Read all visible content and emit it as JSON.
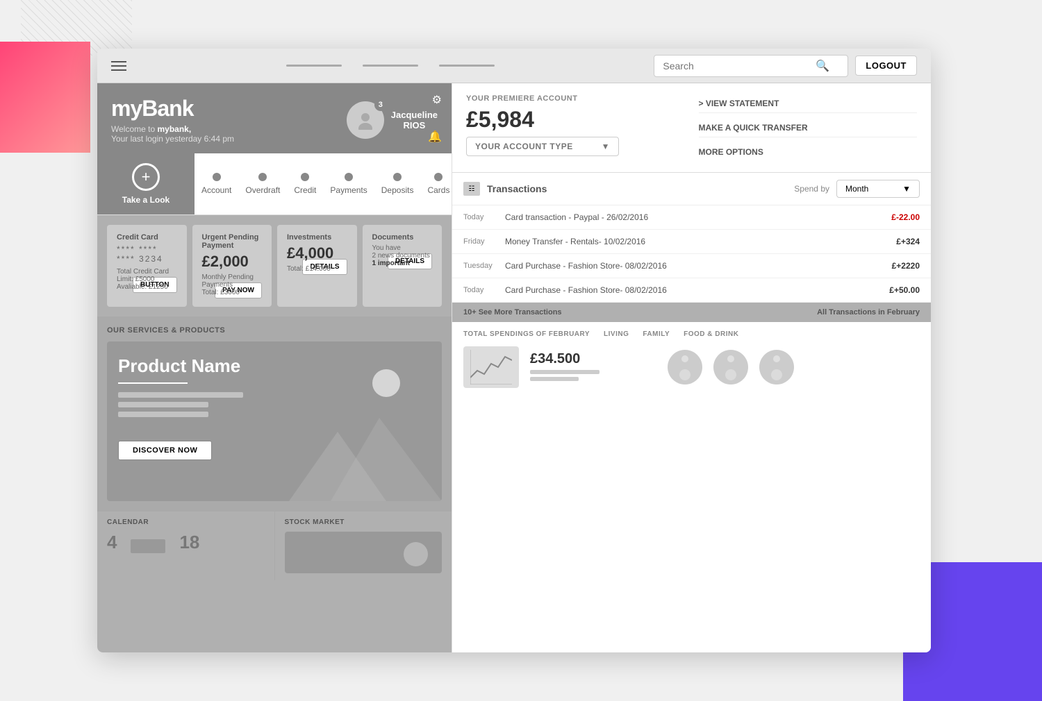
{
  "browser": {
    "hamburger_label": "menu",
    "search_placeholder": "Search",
    "logout_label": "LOGOUT"
  },
  "bank": {
    "logo": "myBank",
    "welcome_text": "Welcome to",
    "welcome_brand": "mybank,",
    "last_login": "Your last login yesterday 6:44 pm",
    "user": {
      "name_line1": "Jacqueline",
      "name_line2": "RIOS",
      "notification_count": "3"
    }
  },
  "nav": {
    "take_look_label": "Take a Look",
    "tabs": [
      {
        "label": "Account"
      },
      {
        "label": "Overdraft"
      },
      {
        "label": "Credit"
      },
      {
        "label": "Payments"
      },
      {
        "label": "Deposits"
      },
      {
        "label": "Cards"
      }
    ]
  },
  "widgets": {
    "credit_card": {
      "title": "Credit Card",
      "masked": "**** **** **** 3234",
      "limit_label": "Total Credit Card Limit: £5000",
      "available_label": "Avaliable: £1250",
      "button_label": "BUTTON"
    },
    "urgent_payment": {
      "title": "Urgent Pending Payment",
      "amount": "£2,000",
      "monthly_label": "Monthly Pending Payments",
      "total_label": "Total: £3000",
      "button_label": "PAY NOW"
    },
    "investments": {
      "title": "Investments",
      "amount": "£4,000",
      "total_label": "Total: £14.000",
      "button_label": "DETAILS"
    },
    "documents": {
      "title": "Documents",
      "line1": "You have",
      "line2": "2 news documents",
      "line3": "1 important",
      "button_label": "DETAILS"
    }
  },
  "services": {
    "section_title": "OUR SERVICES & PRODUCTS",
    "product_name": "Product Name",
    "discover_label": "DISCOVER NOW"
  },
  "bottom": {
    "calendar": {
      "title": "CALENDAR",
      "num1": "4",
      "num2": "18"
    },
    "stock": {
      "title": "STOCK MARKET"
    }
  },
  "account": {
    "premiere_label": "YOUR PREMIERE ACCOUNT",
    "balance": "£5,984",
    "account_type_label": "YOUR ACCOUNT TYPE",
    "view_statement": "> VIEW STATEMENT",
    "quick_transfer": "MAKE A QUICK TRANSFER",
    "more_options": "MORE OPTIONS"
  },
  "transactions": {
    "title": "Transactions",
    "spend_by_label": "Spend by",
    "month_label": "Month",
    "rows": [
      {
        "day": "Today",
        "desc": "Card transaction - Paypal - 26/02/2016",
        "amount": "£-22.00",
        "type": "negative"
      },
      {
        "day": "Friday",
        "desc": "Money Transfer - Rentals- 10/02/2016",
        "amount": "£+324",
        "type": "positive"
      },
      {
        "day": "Tuesday",
        "desc": "Card Purchase - Fashion Store- 08/02/2016",
        "amount": "£+2220",
        "type": "positive"
      },
      {
        "day": "Today",
        "desc": "Card Purchase - Fashion Store- 08/02/2016",
        "amount": "£+50.00",
        "type": "positive"
      }
    ],
    "see_more": "10+ See More Transactions",
    "all_trans": "All Transactions in February"
  },
  "spendings": {
    "title": "TOTAL SPENDINGS OF FEBRUARY",
    "amount": "£34.500",
    "category1": "LIVING",
    "category2": "FAMILY",
    "category3": "FOOD & DRINK"
  }
}
